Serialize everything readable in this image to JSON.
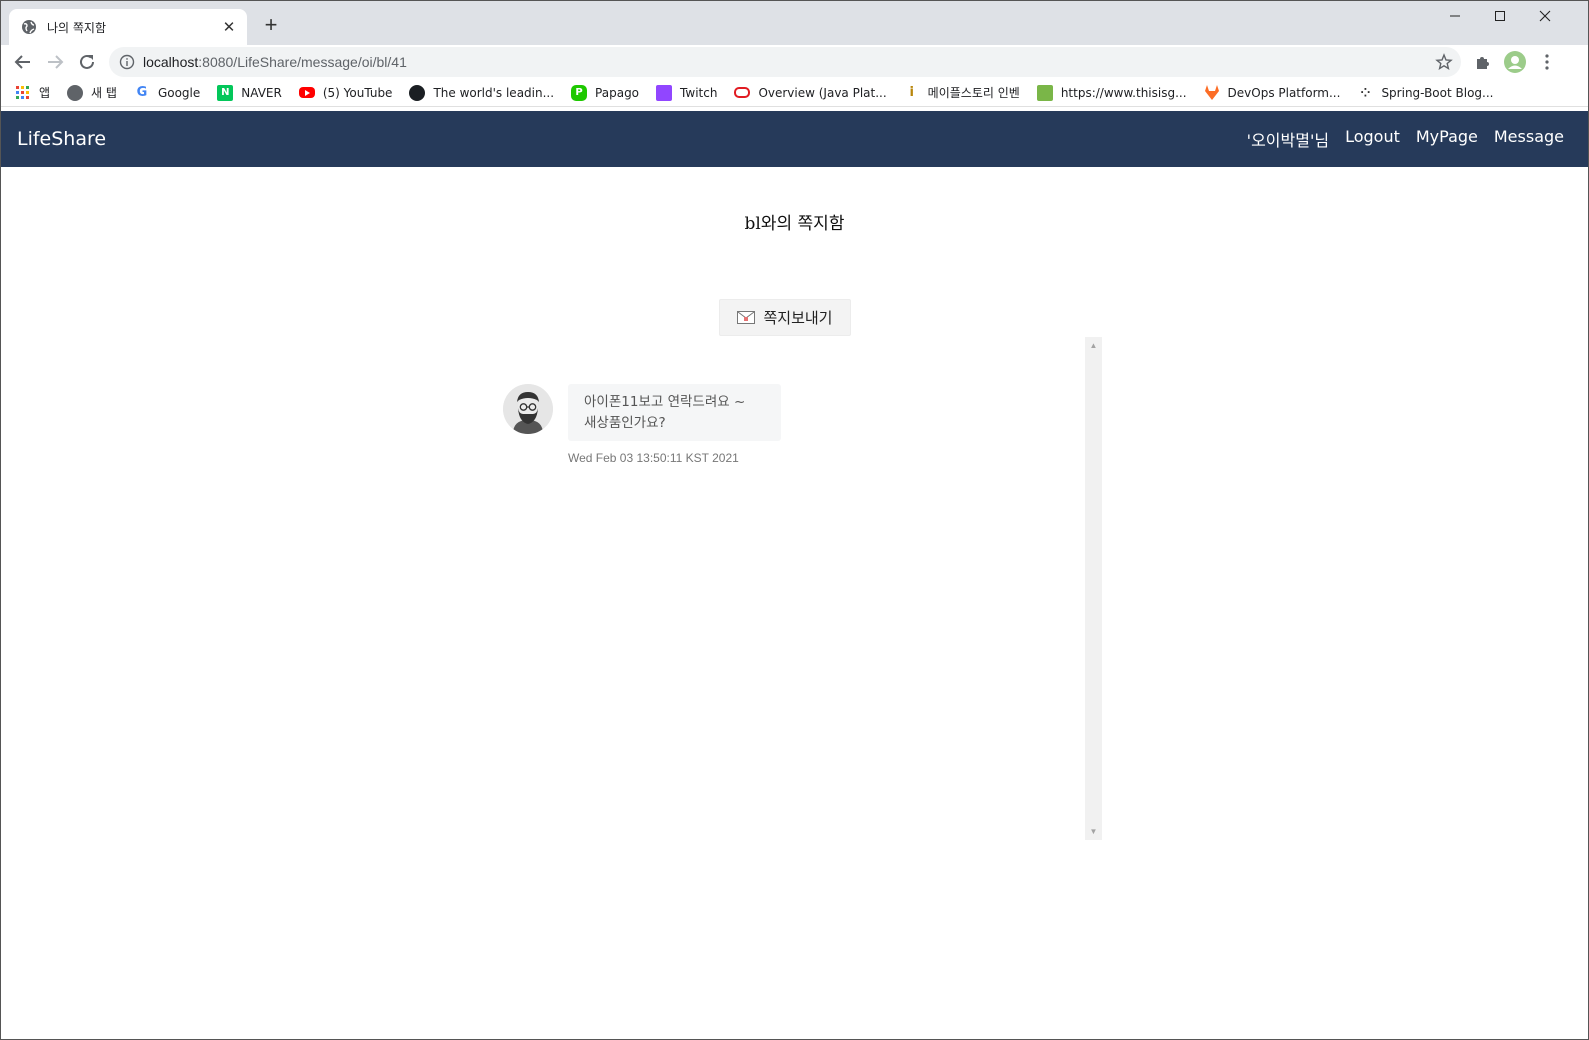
{
  "browser": {
    "tab_title": "나의 쪽지함",
    "url_host": "localhost",
    "url_rest": ":8080/LifeShare/message/oi/bl/41",
    "bookmarks": [
      {
        "label": "앱",
        "icon": "apps-grid-icon"
      },
      {
        "label": "새 탭",
        "icon": "globe-icon"
      },
      {
        "label": "Google",
        "icon": "google-icon"
      },
      {
        "label": "NAVER",
        "icon": "naver-icon"
      },
      {
        "label": "(5) YouTube",
        "icon": "youtube-icon"
      },
      {
        "label": "The world's leadin...",
        "icon": "github-icon"
      },
      {
        "label": "Papago",
        "icon": "papago-icon"
      },
      {
        "label": "Twitch",
        "icon": "twitch-icon"
      },
      {
        "label": "Overview (Java Plat...",
        "icon": "oracle-icon"
      },
      {
        "label": "메이플스토리 인벤",
        "icon": "inven-icon"
      },
      {
        "label": "https://www.thisisg...",
        "icon": "puzzle-site-icon"
      },
      {
        "label": "DevOps Platform...",
        "icon": "gitlab-icon"
      },
      {
        "label": "Spring-Boot Blog...",
        "icon": "dots-icon"
      }
    ]
  },
  "app": {
    "brand": "LifeShare",
    "nav": {
      "user": "'오이박멸'님",
      "logout": "Logout",
      "mypage": "MyPage",
      "message": "Message"
    },
    "page_title": "bl와의 쪽지함",
    "send_button": "쪽지보내기",
    "messages": [
      {
        "line1": "아이폰11보고 연락드려요 ~",
        "line2": "새상품인가요?",
        "timestamp": "Wed Feb 03 13:50:11 KST 2021"
      }
    ]
  },
  "colors": {
    "navbar": "#263a5a",
    "bubble": "#f5f6f7"
  }
}
